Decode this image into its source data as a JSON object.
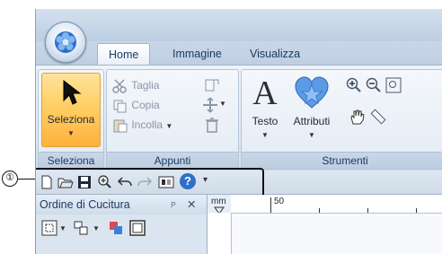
{
  "callout": {
    "number": "①"
  },
  "tabs": [
    {
      "label": "Home",
      "active": true
    },
    {
      "label": "Immagine",
      "active": false
    },
    {
      "label": "Visualizza",
      "active": false
    }
  ],
  "ribbon": {
    "groups": {
      "seleziona": {
        "label": "Seleziona",
        "button_label": "Seleziona"
      },
      "appunti": {
        "label": "Appunti",
        "taglia": "Taglia",
        "copia": "Copia",
        "incolla": "Incolla"
      },
      "strumenti": {
        "label": "Strumenti",
        "testo": "Testo",
        "attributi": "Attributi",
        "testo_glyph": "A"
      }
    }
  },
  "qat": {
    "icons": [
      "new-file-icon",
      "open-folder-icon",
      "save-icon",
      "zoom-icon",
      "undo-icon",
      "redo-icon",
      "view-icon",
      "help-icon"
    ],
    "help_glyph": "?",
    "customize_glyph": "▾"
  },
  "panel": {
    "title": "Ordine di Cucitura",
    "pin_glyph": "ᴩ",
    "close_glyph": "✕"
  },
  "ruler": {
    "unit": "mm",
    "mark": "50"
  },
  "colors": {
    "accent_selected": "#ffcf66",
    "ribbon_text": "#1d3a62",
    "window_frame": "#8aa0b8"
  }
}
